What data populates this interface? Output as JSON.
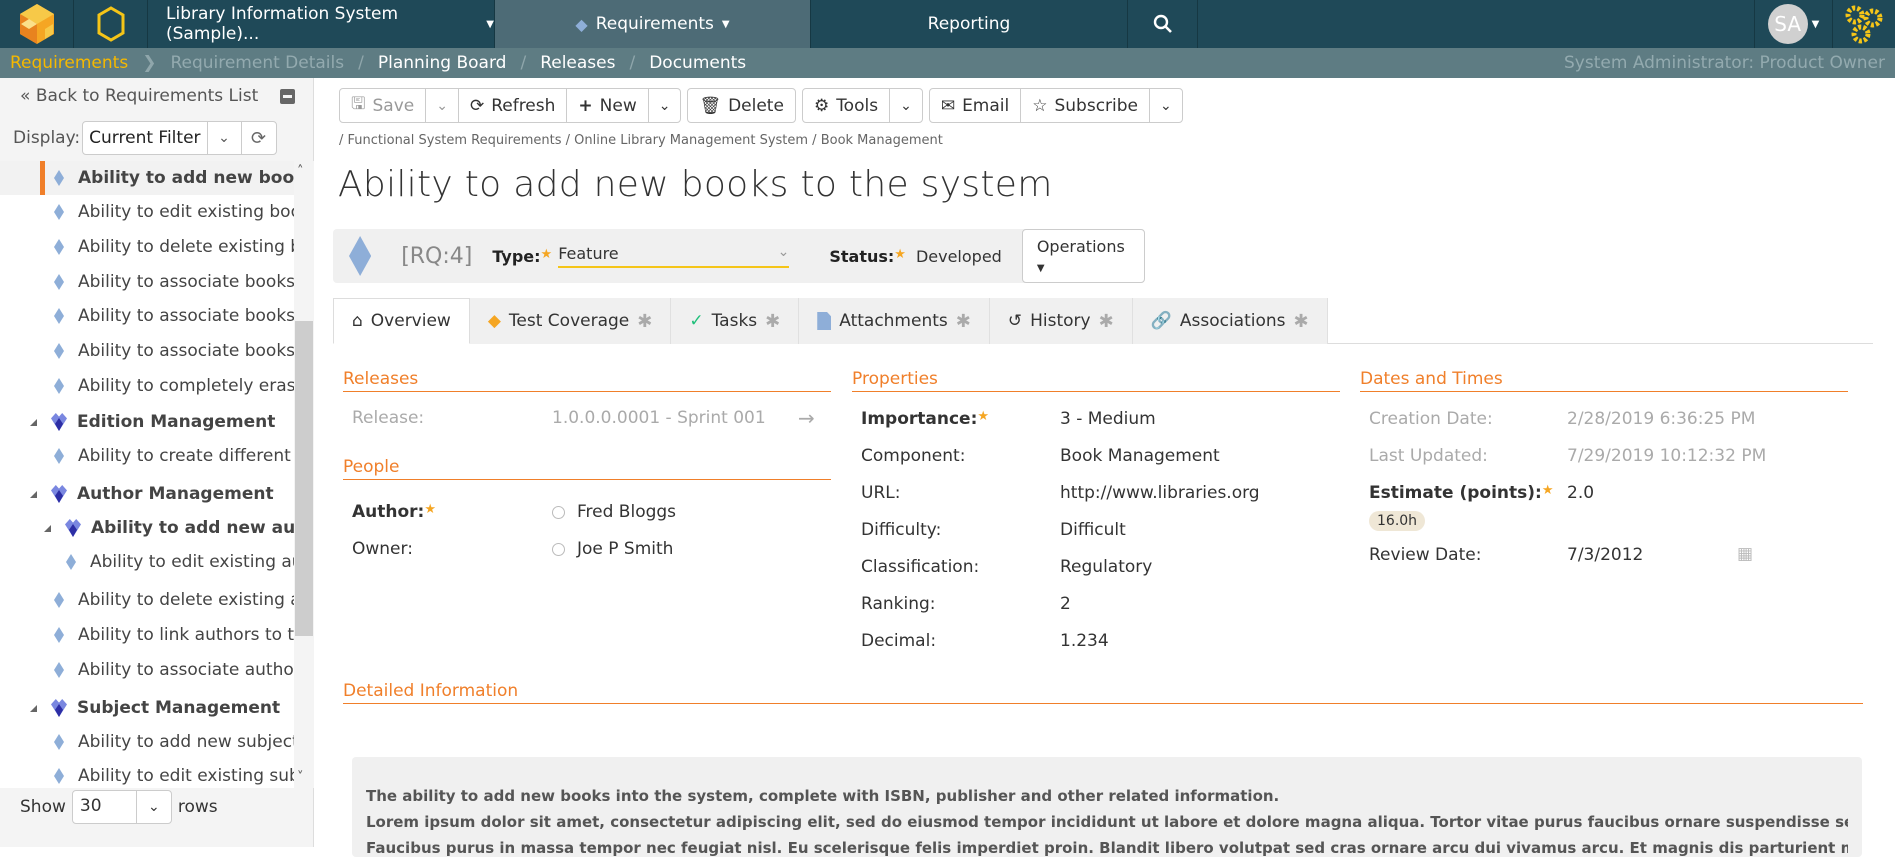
{
  "topbar": {
    "project": "Library Information System (Sample)...",
    "requirements_tab": "Requirements",
    "reporting_tab": "Reporting",
    "avatar_initials": "SA"
  },
  "subbar": {
    "crumbs": [
      "Requirements",
      "Requirement Details",
      "Planning Board",
      "Releases",
      "Documents"
    ],
    "role": "System Administrator: Product Owner"
  },
  "sidebar": {
    "back_label": "Back to Requirements List",
    "display_label": "Display:",
    "display_value": "Current Filter",
    "tree": [
      {
        "label": "Ability to add new books to the system",
        "type": "req",
        "selected": true
      },
      {
        "label": "Ability to edit existing books",
        "type": "req"
      },
      {
        "label": "Ability to delete existing books",
        "type": "req"
      },
      {
        "label": "Ability to associate books with authors",
        "type": "req"
      },
      {
        "label": "Ability to associate books with subjects",
        "type": "req"
      },
      {
        "label": "Ability to associate books with editions",
        "type": "req"
      },
      {
        "label": "Ability to completely erase books",
        "type": "req"
      },
      {
        "label": "Edition Management",
        "type": "folder"
      },
      {
        "label": "Ability to create different editions",
        "type": "req"
      },
      {
        "label": "Author Management",
        "type": "folder"
      },
      {
        "label": "Ability to add new authors",
        "type": "folder2"
      },
      {
        "label": "Ability to edit existing authors",
        "type": "req2"
      },
      {
        "label": "Ability to delete existing authors",
        "type": "req"
      },
      {
        "label": "Ability to link authors to their books",
        "type": "req"
      },
      {
        "label": "Ability to associate authors with subjects",
        "type": "req"
      },
      {
        "label": "Subject Management",
        "type": "folder"
      },
      {
        "label": "Ability to add new subjects",
        "type": "req"
      },
      {
        "label": "Ability to edit existing subjects",
        "type": "req"
      }
    ],
    "show_label": "Show",
    "show_value": "30",
    "rows_label": "rows"
  },
  "toolbar": {
    "save": "Save",
    "refresh": "Refresh",
    "new": "New",
    "delete": "Delete",
    "tools": "Tools",
    "email": "Email",
    "subscribe": "Subscribe"
  },
  "path": "/ Functional System Requirements / Online Library Management System / Book Management",
  "title": "Ability to add new books to the system",
  "header": {
    "id": "[RQ:4]",
    "type_label": "Type:",
    "type_value": "Feature",
    "status_label": "Status:",
    "status_value": "Developed",
    "operations": "Operations"
  },
  "tabs": [
    "Overview",
    "Test Coverage",
    "Tasks",
    "Attachments",
    "History",
    "Associations"
  ],
  "releases": {
    "heading": "Releases",
    "release_label": "Release:",
    "release_value": "1.0.0.0.0001 - Sprint 001"
  },
  "people": {
    "heading": "People",
    "author_label": "Author:",
    "author_value": "Fred Bloggs",
    "owner_label": "Owner:",
    "owner_value": "Joe P Smith"
  },
  "properties": {
    "heading": "Properties",
    "rows": [
      {
        "label": "Importance:",
        "value": "3 - Medium"
      },
      {
        "label": "Component:",
        "value": "Book Management"
      },
      {
        "label": "URL:",
        "value": "http://www.libraries.org"
      },
      {
        "label": "Difficulty:",
        "value": "Difficult"
      },
      {
        "label": "Classification:",
        "value": "Regulatory"
      },
      {
        "label": "Ranking:",
        "value": "2"
      },
      {
        "label": "Decimal:",
        "value": "1.234"
      }
    ]
  },
  "dates": {
    "heading": "Dates and Times",
    "creation_label": "Creation Date:",
    "creation_value": "2/28/2019 6:36:25 PM",
    "updated_label": "Last Updated:",
    "updated_value": "7/29/2019 10:12:32 PM",
    "estimate_label": "Estimate (points):",
    "estimate_value": "2.0",
    "estimate_hours": "16.0h",
    "review_label": "Review Date:",
    "review_value": "7/3/2012"
  },
  "detailed": {
    "heading": "Detailed Information",
    "paragraphs": [
      "The ability to add new books into the system, complete with ISBN, publisher and other related information.",
      "Lorem ipsum dolor sit amet, consectetur adipiscing elit, sed do eiusmod tempor incididunt ut labore et dolore magna aliqua. Tortor vitae purus faucibus ornare suspendisse sed nisi lacus.",
      "Faucibus purus in massa tempor nec feugiat nisl. Eu scelerisque felis imperdiet proin. Blandit libero volutpat sed cras ornare arcu dui vivamus arcu. Et magnis dis parturient montes nascetur"
    ]
  }
}
